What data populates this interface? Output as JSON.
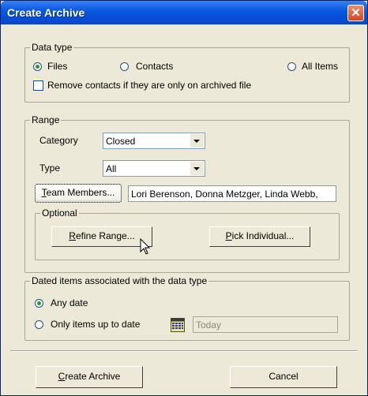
{
  "window": {
    "title": "Create Archive"
  },
  "data_type": {
    "legend": "Data type",
    "options": [
      {
        "label": "Files",
        "selected": true
      },
      {
        "label": "Contacts",
        "selected": false
      },
      {
        "label": "All Items",
        "selected": false
      }
    ],
    "remove_contacts": {
      "label": "Remove contacts if they are only on archived file",
      "checked": false
    }
  },
  "range": {
    "legend": "Range",
    "category_label": "Category",
    "category_value": "Closed",
    "type_label": "Type",
    "type_value": "All",
    "team_members_button_pre": "T",
    "team_members_button_rest": "eam Members...",
    "team_members_value": "Lori Berenson, Donna Metzger, Linda Webb,",
    "optional": {
      "legend": "Optional",
      "refine_pre": "R",
      "refine_rest": "efine Range...",
      "pick_pre": "P",
      "pick_rest": "ick Individual..."
    }
  },
  "dated": {
    "legend": "Dated items associated with the data type",
    "any_date_label": "Any date",
    "up_to_label": "Only items up to date",
    "date_value": "Today",
    "any_date_selected": true
  },
  "footer": {
    "create_pre": "C",
    "create_rest": "reate Archive",
    "cancel_label": "Cancel"
  },
  "icons": [
    "close-icon",
    "calendar-icon",
    "dropdown-arrow-icon",
    "mouse-pointer-icon"
  ],
  "colors": {
    "titlebar": "#0550d6",
    "dialog_bg": "#ece9d8",
    "close_button": "#d9441d"
  }
}
